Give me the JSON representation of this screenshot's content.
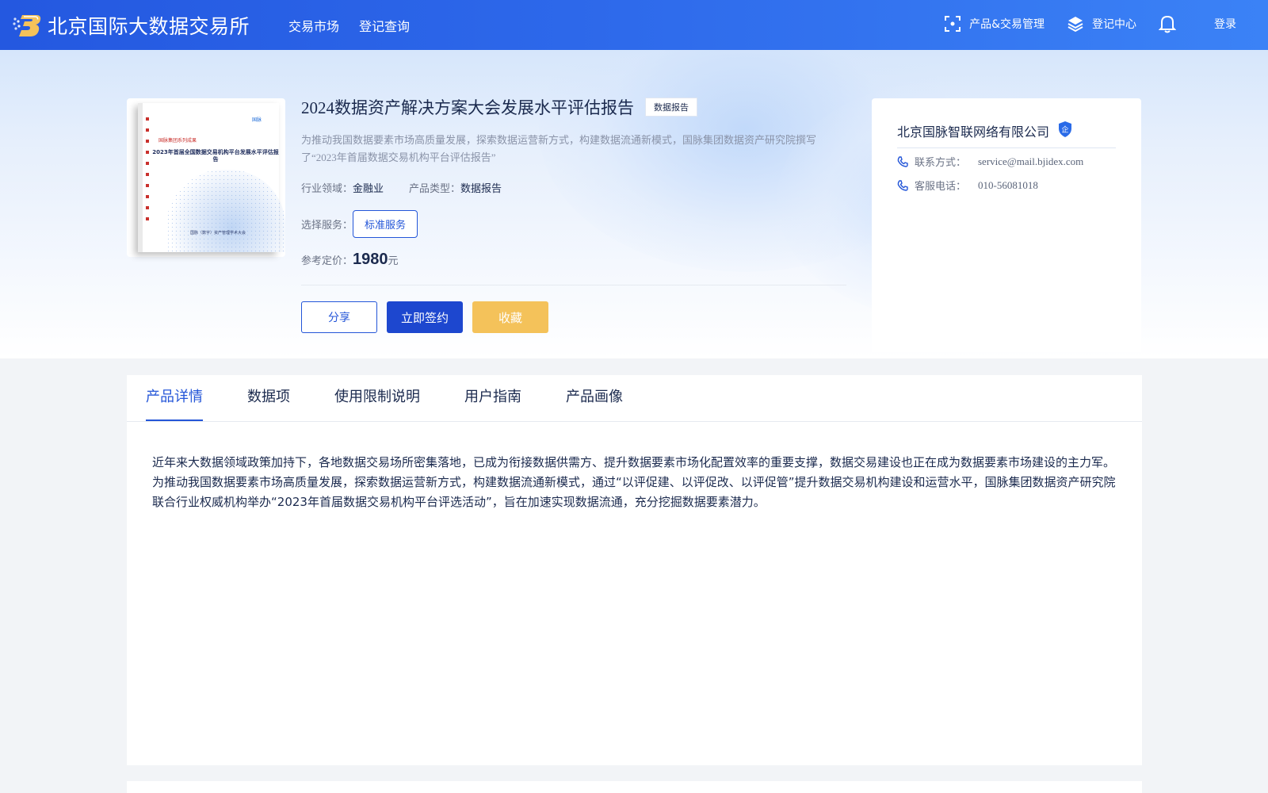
{
  "header": {
    "brand_name": "北京国际大数据交易所",
    "nav": [
      "交易市场",
      "登记查询"
    ],
    "product_mgmt": "产品&交易管理",
    "register_center": "登记中心",
    "login": "登录"
  },
  "product": {
    "title": "2024数据资产解决方案大会发展水平评估报告",
    "tag": "数据报告",
    "description": "为推动我国数据要素市场高质量发展，探索数据运营新方式，构建数据流通新模式，国脉集团数据资产研究院撰写了“2023年首届数据交易机构平台评估报告”",
    "industry_label": "行业领域：",
    "industry_value": "金融业",
    "type_label": "产品类型：",
    "type_value": "数据报告",
    "service_label": "选择服务：",
    "service_option": "标准服务",
    "price_label": "参考定价：",
    "price_value": "1980",
    "price_unit": "元",
    "buttons": {
      "share": "分享",
      "sign": "立即签约",
      "favorite": "收藏"
    },
    "cover": {
      "publisher": "国脉",
      "series": "国脉集团系列成果",
      "title": "2023年首届全国数据交易机构平台发展水平评估报告",
      "footer": "国脉（数字）资产管理学术大会"
    }
  },
  "company": {
    "name": "北京国脉智联网络有限公司",
    "badge": "企",
    "contact_label": "联系方式：",
    "contact_value": "service@mail.bjidex.com",
    "phone_label": "客服电话：",
    "phone_value": "010-56081018"
  },
  "detail": {
    "tabs": [
      "产品详情",
      "数据项",
      "使用限制说明",
      "用户指南",
      "产品画像"
    ],
    "active_tab": 0,
    "content": "近年来大数据领域政策加持下，各地数据交易场所密集落地，已成为衔接数据供需方、提升数据要素市场化配置效率的重要支撑，数据交易建设也正在成为数据要素市场建设的主力军。为推动我国数据要素市场高质量发展，探索数据运营新方式，构建数据流通新模式，通过“以评促建、以评促改、以评促管”提升数据交易机构建设和运营水平，国脉集团数据资产研究院联合行业权威机构举办“2023年首届数据交易机构平台评选活动”，旨在加速实现数据流通，充分挖掘数据要素潜力。"
  },
  "colors": {
    "primary": "#2456d8",
    "header_start": "#2458e0",
    "header_end": "#3b82f6",
    "favorite": "#f4c25a"
  }
}
